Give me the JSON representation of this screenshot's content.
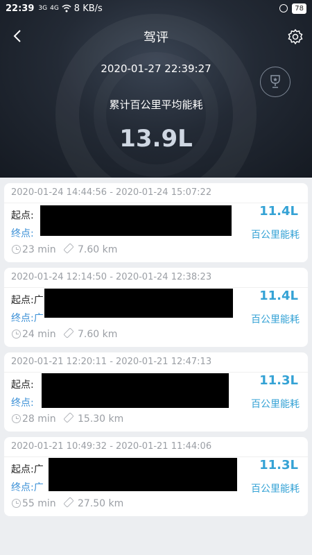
{
  "status_bar": {
    "time": "22:39",
    "signal1": "3G",
    "signal2": "4G",
    "speed": "8 KB/s",
    "battery": "78"
  },
  "nav": {
    "title": "驾评",
    "back_icon": "chevron-left-icon",
    "settings_icon": "gear-icon"
  },
  "summary": {
    "datetime": "2020-01-27 22:39:27",
    "avg_label": "累计百公里平均能耗",
    "avg_value": "13.9L",
    "trophy_icon": "trophy-icon"
  },
  "labels": {
    "start": "起点:",
    "end": "终点:",
    "consumption_unit": "百公里能耗"
  },
  "trips": [
    {
      "range": "2020-01-24 14:44:56 - 2020-01-24 15:07:22",
      "start_addr": "",
      "end_addr": "",
      "duration": "23 min",
      "distance": "7.60 km",
      "consumption": "11.4L"
    },
    {
      "range": "2020-01-24 12:14:50 - 2020-01-24 12:38:23",
      "start_addr": "广",
      "end_addr": "广",
      "duration": "24 min",
      "distance": "7.60 km",
      "consumption": "11.4L"
    },
    {
      "range": "2020-01-21 12:20:11 - 2020-01-21 12:47:13",
      "start_addr": "",
      "end_addr": "",
      "duration": "28 min",
      "distance": "15.30 km",
      "consumption": "11.3L"
    },
    {
      "range": "2020-01-21 10:49:32 - 2020-01-21 11:44:06",
      "start_addr": "广",
      "end_addr": "广",
      "duration": "55 min",
      "distance": "27.50 km",
      "consumption": "11.3L"
    }
  ],
  "colors": {
    "accent": "#34a2d5",
    "end_label": "#3a8fd6",
    "header_bg": "#1c222b"
  }
}
